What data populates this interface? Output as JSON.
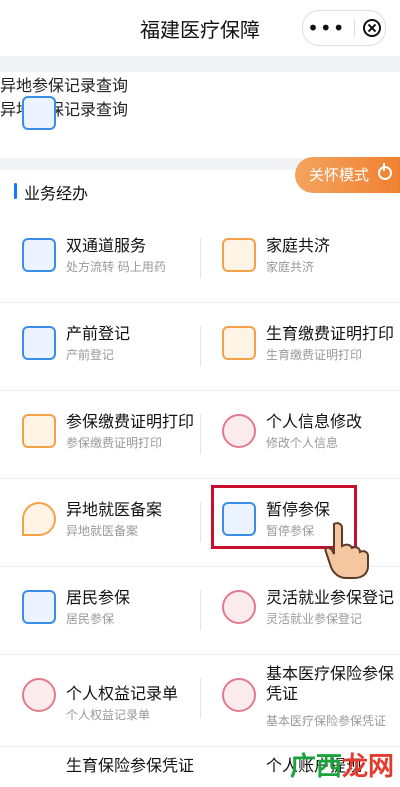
{
  "header": {
    "title": "福建医疗保障"
  },
  "top_item": {
    "title": "异地参保记录查询",
    "subtitle": "异地参保记录查询"
  },
  "section": {
    "title": "业务经办"
  },
  "care_mode": {
    "label": "关怀模式"
  },
  "services": [
    {
      "title": "双通道服务",
      "subtitle": "处方流转 码上用药",
      "icon": "rx-icon"
    },
    {
      "title": "家庭共济",
      "subtitle": "家庭共济",
      "icon": "home-icon"
    },
    {
      "title": "产前登记",
      "subtitle": "产前登记",
      "icon": "prenatal-icon"
    },
    {
      "title": "生育缴费证明打印",
      "subtitle": "生育缴费证明打印",
      "icon": "printer-icon"
    },
    {
      "title": "参保缴费证明打印",
      "subtitle": "参保缴费证明打印",
      "icon": "printer-icon"
    },
    {
      "title": "个人信息修改",
      "subtitle": "修改个人信息",
      "icon": "user-edit-icon"
    },
    {
      "title": "异地就医备案",
      "subtitle": "异地就医备案",
      "icon": "location-plus-icon"
    },
    {
      "title": "暂停参保",
      "subtitle": "暂停参保",
      "icon": "id-card-icon"
    },
    {
      "title": "居民参保",
      "subtitle": "居民参保",
      "icon": "id-card-icon"
    },
    {
      "title": "灵活就业参保登记",
      "subtitle": "灵活就业参保登记",
      "icon": "user-edit-icon"
    },
    {
      "title": "个人权益记录单",
      "subtitle": "个人权益记录单",
      "icon": "user-edit-icon"
    },
    {
      "title": "基本医疗保险参保凭证",
      "subtitle": "基本医疗保险参保凭证",
      "icon": "user-edit-icon"
    },
    {
      "title": "生育保险参保凭证",
      "subtitle": "",
      "icon": "user-edit-icon"
    },
    {
      "title": "个人账户提现",
      "subtitle": "",
      "icon": "user-edit-icon"
    }
  ],
  "watermark": {
    "text_green": "广西",
    "text_red": "龙网"
  }
}
